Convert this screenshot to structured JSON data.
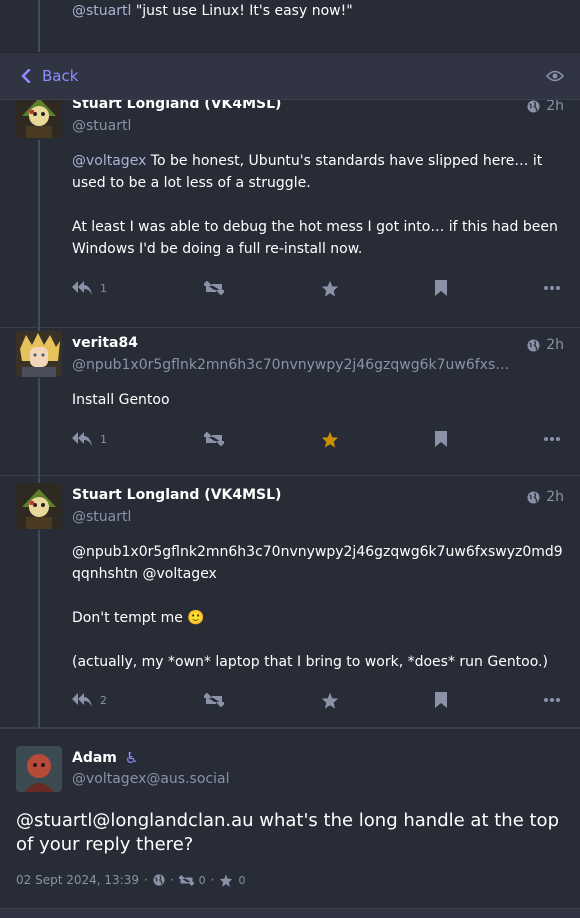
{
  "header": {
    "back_label": "Back",
    "visibility_icon": "eye-icon"
  },
  "top_partial": {
    "text_mention": "@stuartl",
    "text": " \"just use Linux! It's easy now!\""
  },
  "statuses": [
    {
      "name": "Stuart Longland (VK4MSL)",
      "handle": "@stuartl",
      "time": "2h",
      "paragraphs": [
        {
          "mention": "@voltagex",
          "text": " To be honest, Ubuntu's standards have slipped here… it used to be a lot less of a struggle."
        },
        {
          "mention": "",
          "text": "At least I was able to debug the hot mess I got into… if this had been Windows I'd be doing a full re-install now."
        }
      ],
      "reply_count": "1",
      "favourited": false
    },
    {
      "name": "verita84",
      "handle": "@npub1x0r5gflnk2mn6h3c70nvnywpy2j46gzqwg6k7uw6fxswyz…",
      "time": "2h",
      "paragraphs": [
        {
          "mention": "",
          "text": "Install Gentoo"
        }
      ],
      "reply_count": "1",
      "favourited": true
    },
    {
      "name": "Stuart Longland (VK4MSL)",
      "handle": "@stuartl",
      "time": "2h",
      "paragraphs": [
        {
          "mention": "@npub1x0r5gflnk2mn6h3c70nvnywpy2j46gzqwg6k7uw6fxswyz0md9qqnhshtn @voltagex",
          "text": ""
        },
        {
          "mention": "",
          "text": "Don't tempt me 🙂"
        },
        {
          "mention": "",
          "text": "(actually, my *own* laptop that I bring to work, *does* run Gentoo.)"
        }
      ],
      "reply_count": "2",
      "favourited": false
    }
  ],
  "focused": {
    "name": "Adam",
    "badge": "♿",
    "handle": "@voltagex@aus.social",
    "content": "@stuartl@longlandclan.au what's the long handle at the top of your reply there?",
    "date": "02 Sept 2024, 13:39",
    "boost_count": "0",
    "fav_count": "0"
  },
  "colors": {
    "background": "#282c37",
    "header": "#313543",
    "accent": "#8c8dff",
    "favourite": "#ca8f04",
    "muted": "#8a92a8"
  }
}
